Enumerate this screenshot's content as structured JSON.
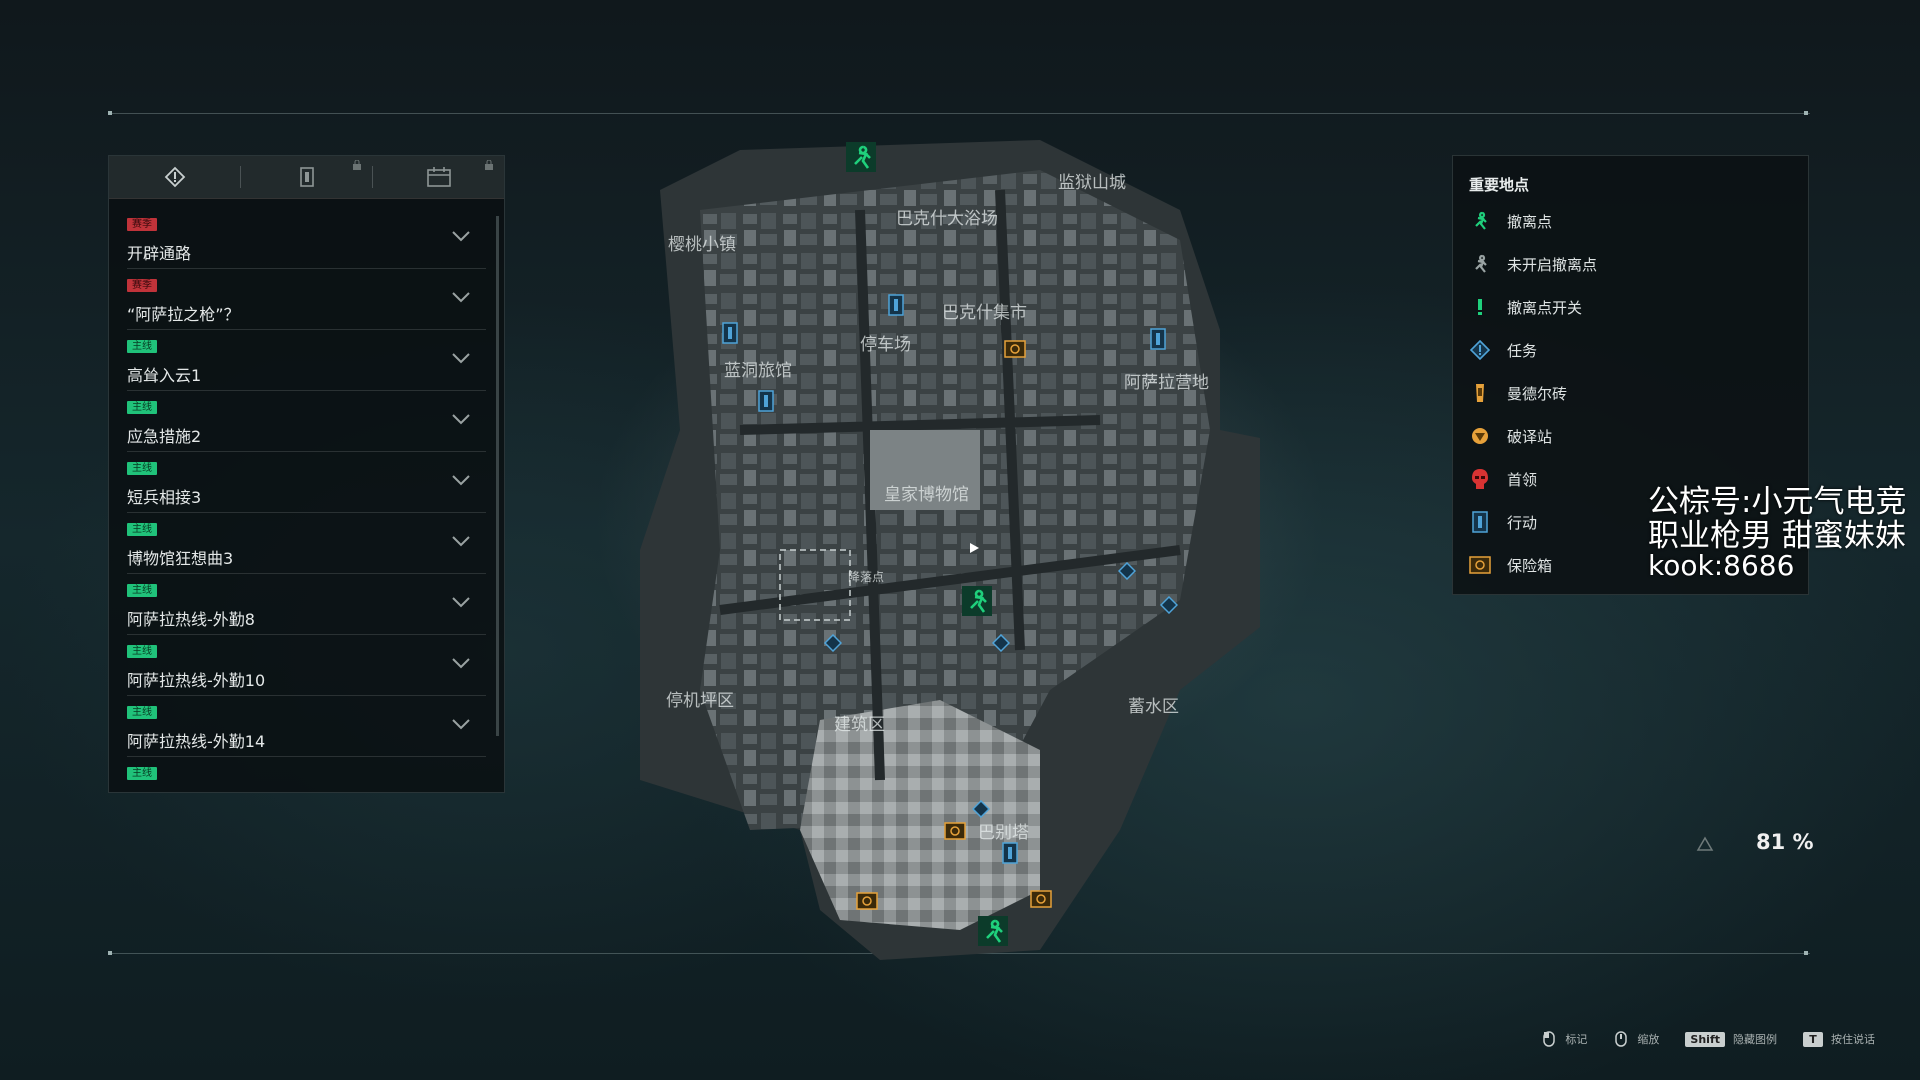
{
  "quests": {
    "tabs": [
      "task-icon",
      "action-icon",
      "calendar-icon"
    ],
    "items": [
      {
        "badge": "赛季",
        "badge_color": "red",
        "title": "开辟通路"
      },
      {
        "badge": "赛季",
        "badge_color": "red",
        "title": "“阿萨拉之枪”？"
      },
      {
        "badge": "主线",
        "badge_color": "green",
        "title": "高耸入云1"
      },
      {
        "badge": "主线",
        "badge_color": "green",
        "title": "应急措施2"
      },
      {
        "badge": "主线",
        "badge_color": "green",
        "title": "短兵相接3"
      },
      {
        "badge": "主线",
        "badge_color": "green",
        "title": "博物馆狂想曲3"
      },
      {
        "badge": "主线",
        "badge_color": "green",
        "title": "阿萨拉热线-外勤8"
      },
      {
        "badge": "主线",
        "badge_color": "green",
        "title": "阿萨拉热线-外勤10"
      },
      {
        "badge": "主线",
        "badge_color": "green",
        "title": "阿萨拉热线-外勤14"
      },
      {
        "badge": "主线",
        "badge_color": "green",
        "title": ""
      }
    ]
  },
  "legend": {
    "title": "重要地点",
    "items": [
      {
        "icon": "exit-runner-icon",
        "label": "撤离点",
        "color": "#1fd07c"
      },
      {
        "icon": "inactive-exit-icon",
        "label": "未开启撤离点",
        "color": "#9aa3a3"
      },
      {
        "icon": "exit-switch-icon",
        "label": "撤离点开关",
        "color": "#1fd07c"
      },
      {
        "icon": "task-diamond-icon",
        "label": "任务",
        "color": "#4fa3d8"
      },
      {
        "icon": "mandel-brick-icon",
        "label": "曼德尔砖",
        "color": "#e6a13a"
      },
      {
        "icon": "decoder-icon",
        "label": "破译站",
        "color": "#e6a13a"
      },
      {
        "icon": "boss-skull-icon",
        "label": "首领",
        "color": "#d83333"
      },
      {
        "icon": "action-icon",
        "label": "行动",
        "color": "#4fa3d8"
      },
      {
        "icon": "safe-icon",
        "label": "保险箱",
        "color": "#e6a13a"
      }
    ]
  },
  "map_labels": {
    "sakura_town": "樱桃小镇",
    "bath": "巴克什大浴场",
    "fortress": "监狱山城",
    "market": "巴克什集市",
    "parking": "停车场",
    "blue_hotel": "蓝洞旅馆",
    "camp": "阿萨拉营地",
    "museum": "皇家博物馆",
    "landing": "降落点",
    "helipad": "停机坪区",
    "construction": "建筑区",
    "reservoir": "蓄水区",
    "babel": "巴别塔"
  },
  "watermark": {
    "line1": "公棕号:小元气电竞",
    "line2": "职业枪男 甜蜜妹妹",
    "line3": "kook:8686"
  },
  "zoom": "81 %",
  "hints": [
    {
      "key_icon": "mouse",
      "label": "标记"
    },
    {
      "key_icon": "mouse-wheel",
      "label": "缩放"
    },
    {
      "key": "Shift",
      "label": "隐藏图例"
    },
    {
      "key": "T",
      "label": "按住说话"
    }
  ]
}
